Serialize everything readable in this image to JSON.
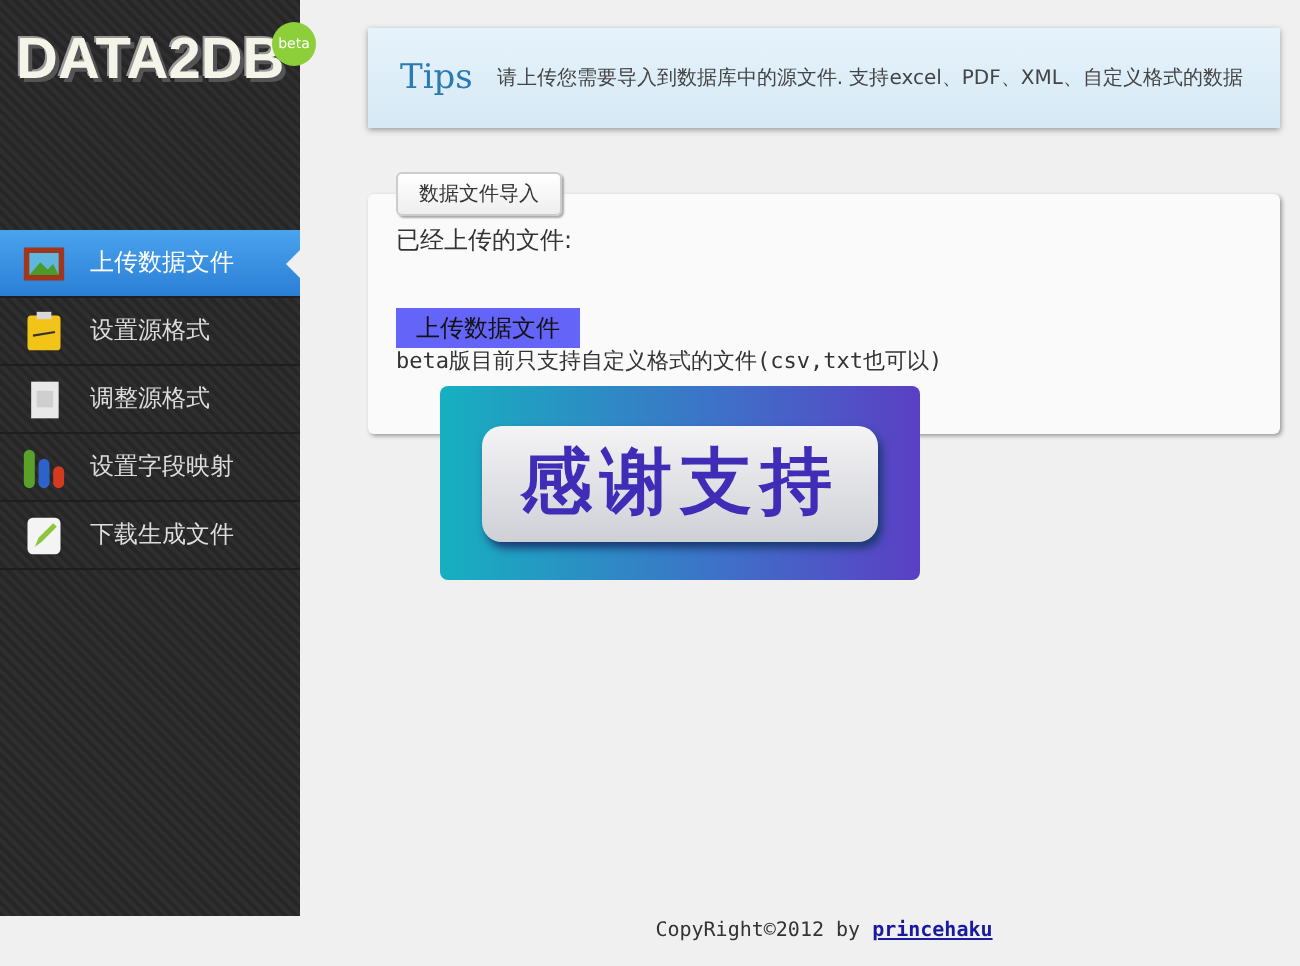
{
  "logo": {
    "title": "DATA2DB",
    "badge": "beta"
  },
  "menu": [
    {
      "label": "上传数据文件",
      "selected": true,
      "kind": "picture-frame"
    },
    {
      "label": "设置源格式",
      "selected": false,
      "kind": "note"
    },
    {
      "label": "调整源格式",
      "selected": false,
      "kind": "page"
    },
    {
      "label": "设置字段映射",
      "selected": false,
      "kind": "bars"
    },
    {
      "label": "下载生成文件",
      "selected": false,
      "kind": "pencil"
    }
  ],
  "tips": {
    "title": "Tips",
    "text": "请上传您需要导入到数据库中的源文件. 支持excel、PDF、XML、自定义格式的数据"
  },
  "panel": {
    "tab": "数据文件导入",
    "uploaded_label": "已经上传的文件:",
    "upload_button": "上传数据文件",
    "note": "beta版目前只支持自定义格式的文件(csv,txt也可以)"
  },
  "overlay": {
    "text": "感谢支持"
  },
  "footer": {
    "text": "CopyRight©2012 by",
    "link": "princehaku"
  }
}
